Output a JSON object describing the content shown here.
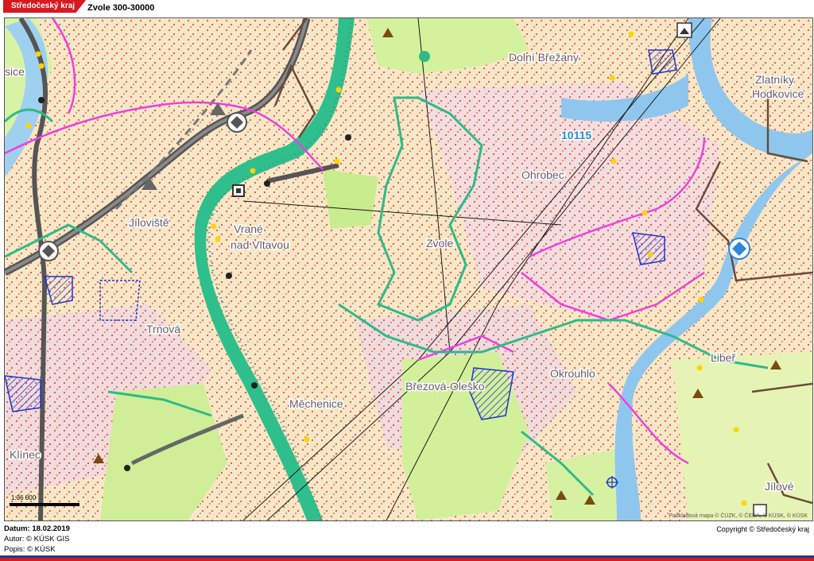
{
  "header": {
    "region": "Středočeský kraj",
    "title": "Zvole 300-30000"
  },
  "map": {
    "places": [
      "Dolní Břežany",
      "Zlatníky",
      "Hodkovice",
      "Ohrobec",
      "Jíloviště",
      "Vrané",
      "nad Vltavou",
      "Zvole",
      "Trnová",
      "Okrouhlo",
      "Libeř",
      "Březová-Oleško",
      "Měchenice",
      "Klínec",
      "Jílové",
      "Jíloviště-sice"
    ],
    "place_short_left": "sice",
    "road_number": "10115",
    "scale_label": "1:36 000",
    "attribution": "Podkladová mapa © ČÚZK, © ČEDA, © KÚSK, © KÚSK",
    "colors": {
      "background": "#f6e8c6",
      "forest": "#d9f2a2",
      "river": "#8fc6ee",
      "boundary_pink": "#ee3fe2",
      "boundary_brown": "#6b4a3a",
      "corridor_green": "#2fba88",
      "dots": "#e53030"
    }
  },
  "footer": {
    "date": "Datum: 18.02.2019",
    "author": "Autor: © KÚSK GIS",
    "legend": "Popis: © KÚSK",
    "copyright": "Copyright © Středočeský kraj"
  }
}
